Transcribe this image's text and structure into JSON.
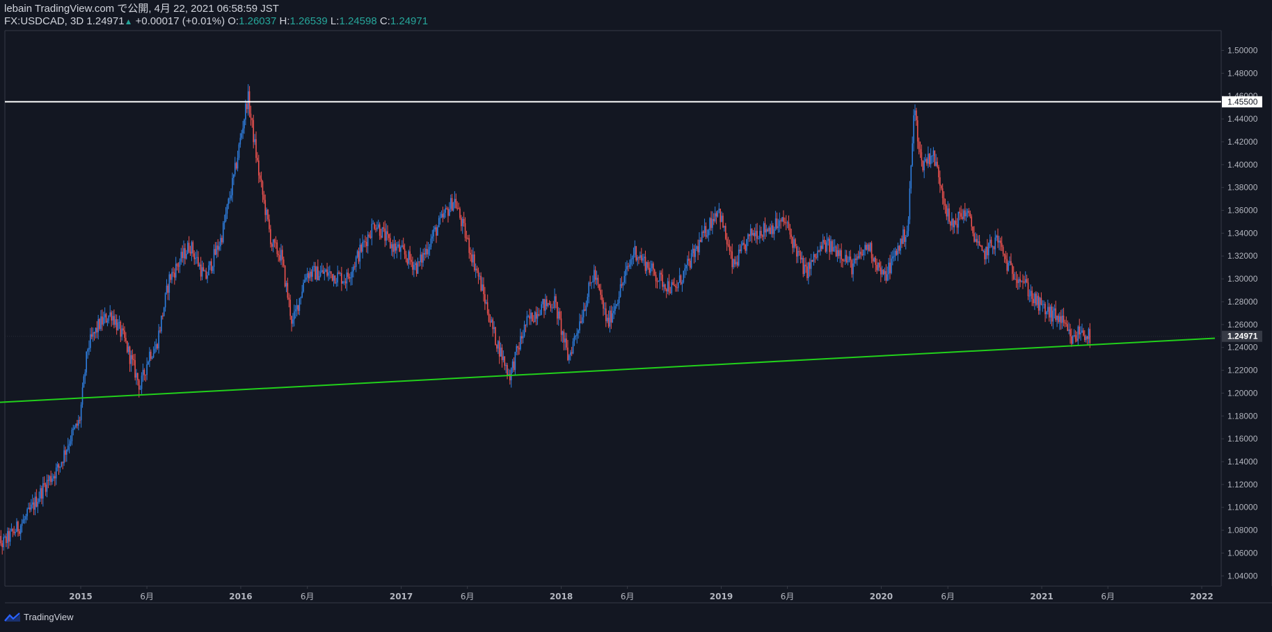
{
  "header": {
    "line1": "lebain TradingView.com で公開, 4月 22, 2021 06:58:59 JST",
    "symbol": "FX:USDCAD, 3D",
    "last": "1.24971",
    "arrow": "▲",
    "change": "+0.00017 (+0.01%)",
    "o_label": "O:",
    "o": "1.26037",
    "h_label": "H:",
    "h": "1.26539",
    "l_label": "L:",
    "l": "1.24598",
    "c_label": "C:",
    "c": "1.24971"
  },
  "branding": {
    "label": "TradingView",
    "icon": "tradingview-logo-icon"
  },
  "colors": {
    "background": "#131722",
    "up": "#2f7fe0",
    "down": "#ef5350",
    "support_line": "#22d11b",
    "resistance_line": "#ffffff",
    "axis_text": "#b2b5be",
    "ohlc_value": "#26a69a"
  },
  "chart_data": {
    "type": "candlestick",
    "symbol": "FX:USDCAD",
    "interval": "3D",
    "ylim": [
      1.03,
      1.51
    ],
    "yticks": [
      "1.50000",
      "1.48000",
      "1.46000",
      "1.44000",
      "1.42000",
      "1.40000",
      "1.38000",
      "1.36000",
      "1.34000",
      "1.32000",
      "1.30000",
      "1.28000",
      "1.26000",
      "1.24000",
      "1.22000",
      "1.20000",
      "1.18000",
      "1.16000",
      "1.14000",
      "1.12000",
      "1.10000",
      "1.08000",
      "1.06000",
      "1.04000"
    ],
    "xlim": [
      "2014-06-10",
      "2022-01-31"
    ],
    "xticks": [
      {
        "date": "2015-01-01",
        "label": "2015"
      },
      {
        "date": "2015-06-01",
        "label": "6月"
      },
      {
        "date": "2016-01-01",
        "label": "2016"
      },
      {
        "date": "2016-06-01",
        "label": "6月"
      },
      {
        "date": "2017-01-01",
        "label": "2017"
      },
      {
        "date": "2017-06-01",
        "label": "6月"
      },
      {
        "date": "2018-01-01",
        "label": "2018"
      },
      {
        "date": "2018-06-01",
        "label": "6月"
      },
      {
        "date": "2019-01-01",
        "label": "2019"
      },
      {
        "date": "2019-06-01",
        "label": "6月"
      },
      {
        "date": "2020-01-01",
        "label": "2020"
      },
      {
        "date": "2020-06-01",
        "label": "6月"
      },
      {
        "date": "2021-01-01",
        "label": "2021"
      },
      {
        "date": "2021-06-01",
        "label": "6月"
      },
      {
        "date": "2022-01-01",
        "label": "2022"
      }
    ],
    "price_path": [
      [
        "2014-06-12",
        1.075
      ],
      [
        "2014-07-10",
        1.068
      ],
      [
        "2014-09-01",
        1.09
      ],
      [
        "2014-10-15",
        1.12
      ],
      [
        "2014-11-15",
        1.135
      ],
      [
        "2014-12-10",
        1.16
      ],
      [
        "2015-01-01",
        1.175
      ],
      [
        "2015-01-20",
        1.24
      ],
      [
        "2015-02-15",
        1.26
      ],
      [
        "2015-03-15",
        1.27
      ],
      [
        "2015-04-15",
        1.245
      ],
      [
        "2015-05-20",
        1.205
      ],
      [
        "2015-06-10",
        1.235
      ],
      [
        "2015-06-25",
        1.24
      ],
      [
        "2015-07-25",
        1.3
      ],
      [
        "2015-09-10",
        1.33
      ],
      [
        "2015-10-15",
        1.3
      ],
      [
        "2015-11-20",
        1.335
      ],
      [
        "2015-12-20",
        1.39
      ],
      [
        "2016-01-20",
        1.46
      ],
      [
        "2016-02-15",
        1.39
      ],
      [
        "2016-03-15",
        1.33
      ],
      [
        "2016-04-05",
        1.32
      ],
      [
        "2016-05-01",
        1.26
      ],
      [
        "2016-06-01",
        1.305
      ],
      [
        "2016-07-20",
        1.305
      ],
      [
        "2016-09-01",
        1.3
      ],
      [
        "2016-11-05",
        1.35
      ],
      [
        "2016-12-10",
        1.33
      ],
      [
        "2017-01-01",
        1.325
      ],
      [
        "2017-02-10",
        1.31
      ],
      [
        "2017-03-20",
        1.34
      ],
      [
        "2017-05-05",
        1.37
      ],
      [
        "2017-05-25",
        1.345
      ],
      [
        "2017-07-01",
        1.3
      ],
      [
        "2017-08-05",
        1.25
      ],
      [
        "2017-09-08",
        1.215
      ],
      [
        "2017-10-15",
        1.26
      ],
      [
        "2017-11-15",
        1.275
      ],
      [
        "2017-12-20",
        1.28
      ],
      [
        "2018-01-20",
        1.23
      ],
      [
        "2018-03-20",
        1.305
      ],
      [
        "2018-04-20",
        1.26
      ],
      [
        "2018-06-20",
        1.325
      ],
      [
        "2018-08-15",
        1.3
      ],
      [
        "2018-09-20",
        1.29
      ],
      [
        "2018-10-25",
        1.315
      ],
      [
        "2018-12-28",
        1.363
      ],
      [
        "2019-01-31",
        1.31
      ],
      [
        "2019-03-15",
        1.34
      ],
      [
        "2019-04-25",
        1.345
      ],
      [
        "2019-05-30",
        1.35
      ],
      [
        "2019-07-15",
        1.305
      ],
      [
        "2019-08-25",
        1.33
      ],
      [
        "2019-10-01",
        1.325
      ],
      [
        "2019-10-31",
        1.31
      ],
      [
        "2019-12-05",
        1.33
      ],
      [
        "2020-01-10",
        1.3
      ],
      [
        "2020-02-15",
        1.33
      ],
      [
        "2020-03-05",
        1.345
      ],
      [
        "2020-03-19",
        1.45
      ],
      [
        "2020-04-05",
        1.4
      ],
      [
        "2020-04-30",
        1.41
      ],
      [
        "2020-05-15",
        1.39
      ],
      [
        "2020-06-10",
        1.345
      ],
      [
        "2020-07-15",
        1.36
      ],
      [
        "2020-08-20",
        1.32
      ],
      [
        "2020-09-25",
        1.335
      ],
      [
        "2020-10-20",
        1.31
      ],
      [
        "2020-11-20",
        1.3
      ],
      [
        "2020-12-20",
        1.28
      ],
      [
        "2021-01-20",
        1.27
      ],
      [
        "2021-02-15",
        1.265
      ],
      [
        "2021-03-15",
        1.245
      ],
      [
        "2021-04-01",
        1.255
      ],
      [
        "2021-04-22",
        1.2497
      ]
    ],
    "horizontal_line": {
      "price": 1.455,
      "label": "1.45500"
    },
    "trend_line": [
      [
        "2014-06-10",
        1.1915
      ],
      [
        "2022-01-31",
        1.248
      ]
    ],
    "last_price": {
      "price": 1.24971,
      "label": "1.24971"
    },
    "grid": false,
    "legend": "none"
  }
}
